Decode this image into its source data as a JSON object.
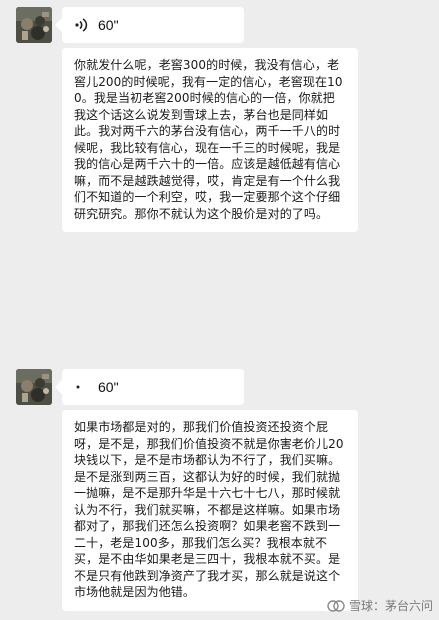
{
  "messages": [
    {
      "avatar": "user-avatar",
      "voice": {
        "duration": "60\"",
        "icon": "voice-wave-icon"
      },
      "transcript": "你就发什么呢，老窖300的时候，我没有信心，老窖儿200的时候呢，我有一定的信心，老窖现在100。我是当初老窖200时候的信心的一倍，你就把我这个话这么说发到雪球上去，茅台也是同样如此。我对两千六的茅台没有信心，两千一千八的时候呢，我比较有信心，现在一千三的时候呢，我是我的信心是两千六十的一倍。应该是越低越有信心嘛，而不是越跌越觉得，哎，肯定是有一个什么我们不知道的一个利空，哎，我一定要那个这个仔细研究研究。那你不就认为这个股价是对的了吗。"
    },
    {
      "avatar": "user-avatar",
      "voice": {
        "duration": "60\"",
        "icon": "voice-dot-icon"
      },
      "transcript": "如果市场都是对的，那我们价值投资还投资个屁呀，是不是，那我们价值投资不就是你害老价儿20块钱以下，是不是市场都认为不行了，我们买嘛。是不是涨到两三百，这都认为好的时候，我们就抛一抛嘛，是不是那升华是十六七十七八，那时候就认为不行，我们就买嘛，不都是这样嘛。如果市场都对了，那我们还怎么投资啊？如果老窖不跌到一二十，老是100多，那我们怎么买？我根本就不买，是不由华如果老是三四十，我根本就不买。是不是只有他跌到净资产了我才买，那么就是说这个市场他就是因为他错。"
    }
  ],
  "watermark": {
    "text": "雪球：茅台六问",
    "logo": "snowball-logo-icon"
  },
  "colors": {
    "background": "#ededed",
    "bubble": "#ffffff",
    "text": "#191919"
  }
}
